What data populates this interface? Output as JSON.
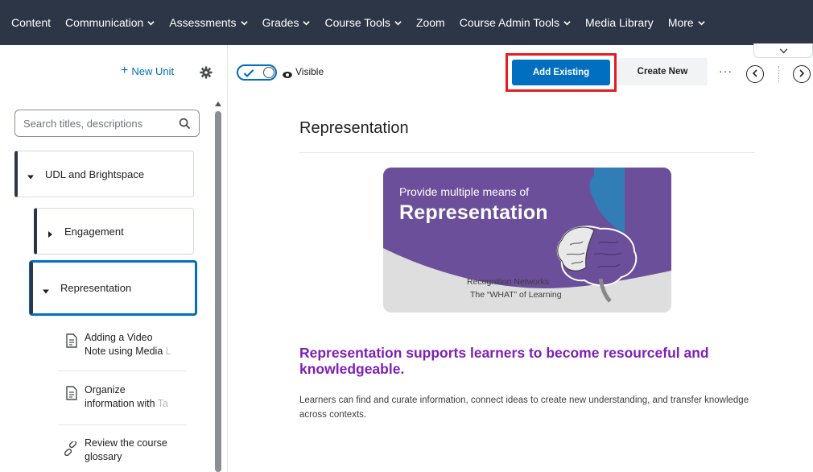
{
  "nav": {
    "items": [
      {
        "label": "Content",
        "has_menu": false
      },
      {
        "label": "Communication",
        "has_menu": true
      },
      {
        "label": "Assessments",
        "has_menu": true
      },
      {
        "label": "Grades",
        "has_menu": true
      },
      {
        "label": "Course Tools",
        "has_menu": true
      },
      {
        "label": "Zoom",
        "has_menu": false
      },
      {
        "label": "Course Admin Tools",
        "has_menu": true
      },
      {
        "label": "Media Library",
        "has_menu": false
      },
      {
        "label": "More",
        "has_menu": true
      }
    ]
  },
  "sidebar": {
    "new_unit_label": "New Unit",
    "search_placeholder": "Search titles, descriptions",
    "units": [
      {
        "label": "UDL and Brightspace",
        "expanded": true
      },
      {
        "label": "Engagement",
        "expanded": false
      },
      {
        "label": "Representation",
        "expanded": true,
        "selected": true
      }
    ],
    "topics": [
      {
        "line1": "Adding a Video",
        "line2": "Note using Media",
        "line2_fade": " L",
        "icon": "document-icon"
      },
      {
        "line1": "Organize",
        "line2": "information with",
        "line2_fade": " Ta",
        "icon": "document-icon"
      },
      {
        "line1": "Review the course",
        "line2": "glossary",
        "line2_fade": "",
        "icon": "link-icon"
      }
    ]
  },
  "toolbar": {
    "visible_label": "Visible",
    "add_existing_label": "Add Existing",
    "create_new_label": "Create New",
    "more_label": "···"
  },
  "main": {
    "title": "Representation",
    "banner": {
      "line1": "Provide multiple means of",
      "line2": "Representation",
      "line3": "Recognition Networks",
      "line4": "The “WHAT” of Learning",
      "colors": {
        "purple": "#6c4f9a",
        "blue": "#2f7fb6",
        "gray": "#dedede"
      }
    },
    "headline": "Representation supports learners to become resourceful and knowledgeable.",
    "body": "Learners can find and curate information, connect ideas to create new understanding, and transfer knowledge across contexts."
  },
  "colors": {
    "nav_bg": "#2d3647",
    "accent": "#006fbf",
    "highlight_box": "#e41b23",
    "headline": "#7e1fb6"
  }
}
